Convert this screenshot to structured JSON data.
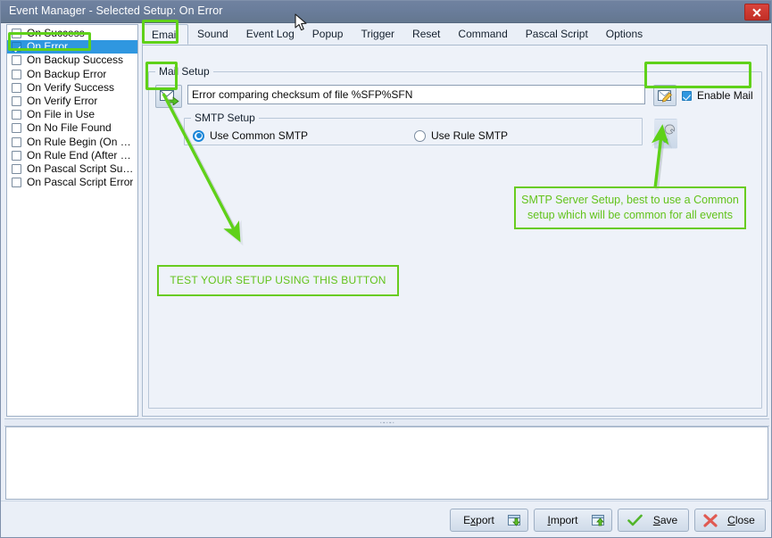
{
  "window": {
    "title": "Event Manager - Selected Setup: On Error",
    "close_icon": "close-icon"
  },
  "event_list": [
    {
      "label": "On Success",
      "checked": false,
      "selected": false
    },
    {
      "label": "On Error",
      "checked": true,
      "selected": true
    },
    {
      "label": "On Backup Success",
      "checked": false,
      "selected": false
    },
    {
      "label": "On Backup Error",
      "checked": false,
      "selected": false
    },
    {
      "label": "On Verify Success",
      "checked": false,
      "selected": false
    },
    {
      "label": "On Verify Error",
      "checked": false,
      "selected": false
    },
    {
      "label": "On File in Use",
      "checked": false,
      "selected": false
    },
    {
      "label": "On No File Found",
      "checked": false,
      "selected": false
    },
    {
      "label": "On Rule Begin (On Scan)",
      "checked": false,
      "selected": false
    },
    {
      "label": "On Rule End (After Scan)",
      "checked": false,
      "selected": false
    },
    {
      "label": "On Pascal Script Success",
      "checked": false,
      "selected": false
    },
    {
      "label": "On Pascal Script Error",
      "checked": false,
      "selected": false
    }
  ],
  "tabs": [
    {
      "label": "Email",
      "active": true
    },
    {
      "label": "Sound",
      "active": false
    },
    {
      "label": "Event Log",
      "active": false
    },
    {
      "label": "Popup",
      "active": false
    },
    {
      "label": "Trigger",
      "active": false
    },
    {
      "label": "Reset",
      "active": false
    },
    {
      "label": "Command",
      "active": false
    },
    {
      "label": "Pascal Script",
      "active": false
    },
    {
      "label": "Options",
      "active": false
    }
  ],
  "mail_setup": {
    "group_title": "Mail Setup",
    "test_button_icon": "send-mail-icon",
    "subject_value": "Error comparing checksum of file %SFP%SFN",
    "subject_placeholder": "",
    "edit_button_icon": "compose-mail-icon",
    "enable_mail_label": "Enable Mail",
    "enable_mail_checked": true,
    "smtp": {
      "group_title": "SMTP Setup",
      "options": [
        {
          "label": "Use Common SMTP",
          "selected": true
        },
        {
          "label": "Use Rule SMTP",
          "selected": false
        }
      ],
      "config_button_icon": "wrench-icon"
    }
  },
  "annotations": {
    "test_button_note": "TEST YOUR SETUP USING THIS BUTTON",
    "smtp_note": "SMTP Server Setup, best to use a Common setup which will be common for all events",
    "highlight_color": "#5fd119",
    "note_text_color": "#62c31b"
  },
  "footer": {
    "buttons": [
      {
        "label": "Export",
        "mnemonic": "x",
        "icon": "export-icon"
      },
      {
        "label": "Import",
        "mnemonic": "I",
        "icon": "import-icon"
      },
      {
        "label": "Save",
        "mnemonic": "S",
        "icon": "check-icon"
      },
      {
        "label": "Close",
        "mnemonic": "C",
        "icon": "close-x-icon"
      }
    ]
  },
  "colors": {
    "titlebar": "#6a7d9b",
    "selection": "#2f97e0",
    "accent": "#1a86d8",
    "panel": "#eef2f9",
    "close_red": "#c22f27"
  }
}
